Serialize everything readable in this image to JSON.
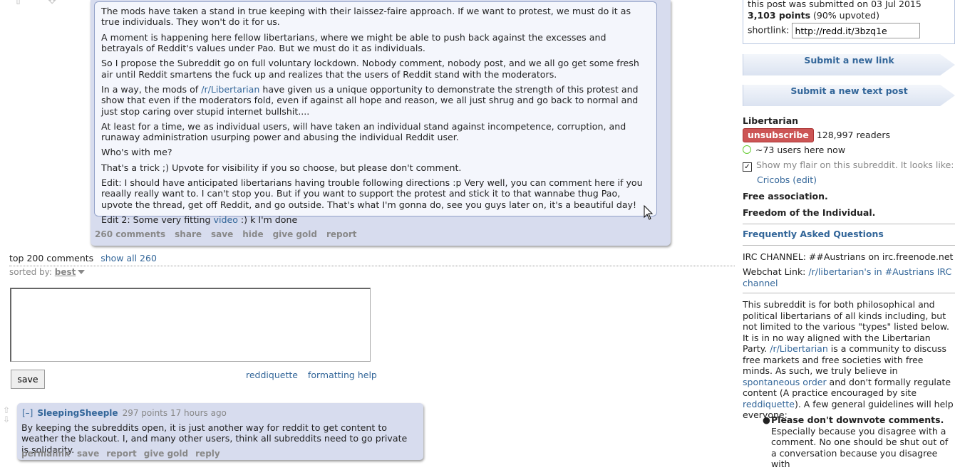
{
  "post": {
    "paragraphs": [
      "The mods have taken a stand in true keeping with their laissez-faire approach. If we want to protest, we must do it as true individuals. They won't do it for us.",
      "A moment is happening here fellow libertarians, where we might be able to push back against the excesses and betrayals of Reddit's values under Pao. But we must do it as individuals.",
      "So I propose the Subreddit go on full voluntary lockdown. Nobody comment, nobody post, and we all go get some fresh air until Reddit smartens the fuck up and realizes that the users of Reddit stand with the moderators."
    ],
    "p4_pre": "In a way, the mods of ",
    "p4_link": "/r/Libertarian",
    "p4_post": " have given us a unique opportunity to demonstrate the strength of this protest and show that even if the moderators fold, even if against all hope and reason, we all just shrug and go back to normal and just stop caring over stupid internet bullshit....",
    "p5": "At least for a time, we as individual users, will have taken an individual stand against incompetence, corruption, and runaway administration usurping power and abusing the individual Reddit user.",
    "p6": "Who's with me?",
    "p7": "That's a trick ;) Upvote for visibility if you so choose, but please don't comment.",
    "p8": "Edit: I should have anticipated libertarians having trouble following directions :p Very well, you can comment here if you reaally really want to. I can't stop you. But if you want to support the protest and stick it to that wannabe thug Pao, upvote the thread, get off Reddit, and go outside. That's what I'm gonna do, see you guys later on, it's a beautiful day!",
    "p9_pre": "Edit 2: Some very fitting ",
    "p9_link": "video",
    "p9_post": " :) k I'm done",
    "actions": [
      "260 comments",
      "share",
      "save",
      "hide",
      "give gold",
      "report"
    ]
  },
  "comments_header": {
    "top": "top 200 comments",
    "show_all": "show all 260",
    "sorted_label": "sorted by:",
    "sorted_value": "best"
  },
  "comment_form": {
    "save": "save",
    "reddiquette": "reddiquette",
    "formatting_help": "formatting help"
  },
  "comment": {
    "expand": "[–]",
    "author": "SleepingSheeple",
    "meta": "297 points 17 hours ago",
    "body": "By keeping the subreddits open, it is just another way for reddit to get content to weather the blackout. I, and many other users, think all subreddits need to go private is solidarity.",
    "actions": [
      "permalink",
      "save",
      "report",
      "give gold",
      "reply"
    ]
  },
  "sidebar": {
    "submitted": "this post was submitted on 03 Jul 2015",
    "points": "3,103 points",
    "upvoted": "(90% upvoted)",
    "shortlink_label": "shortlink:",
    "shortlink_value": "http://redd.it/3bzq1e",
    "submit_link": "Submit a new link",
    "submit_text": "Submit a new text post",
    "subreddit_name": "Libertarian",
    "unsubscribe": "unsubscribe",
    "readers": "128,997 readers",
    "users_here": "~73 users here now",
    "flair_text": "Show my flair on this subreddit. It looks like:",
    "flair_value": "Cricobs",
    "flair_edit": "(edit)",
    "free_association": "Free association.",
    "freedom": "Freedom of the Individual.",
    "faq": "Frequently Asked Questions",
    "irc": "IRC CHANNEL: ##Austrians on irc.freenode.net",
    "webchat_label": "Webchat Link: ",
    "webchat_link": "/r/libertarian's in #Austrians IRC channel",
    "desc_1": "This subreddit is for both philosophical and political libertarians of all kinds including, but not limited to the various \"types\" listed below. It is in no way aligned with the Libertarian Party. ",
    "desc_link1": "/r/Libertarian",
    "desc_2": " is a community to discuss free markets and free societies with free minds. As such, we truly believe in ",
    "desc_link2": "spontaneous order",
    "desc_3": " and don't formally regulate content (A practice encouraged by site ",
    "desc_link3": "reddiquette",
    "desc_4": "). A few general guidelines will help everyone:",
    "rule_title": "Please don't downvote comments.",
    "rule_text": "Especially because you disagree with a comment. No one should be shut out of a conversation because you disagree with"
  }
}
